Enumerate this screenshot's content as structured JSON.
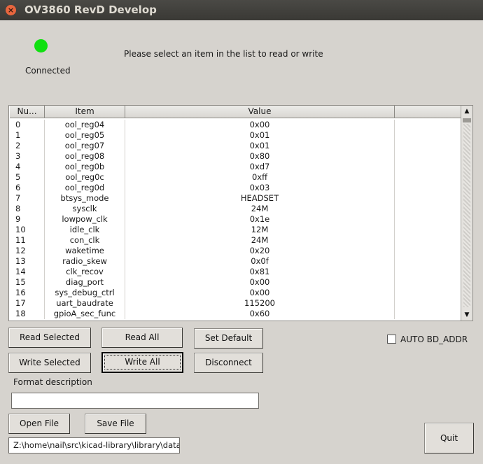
{
  "window": {
    "title": "OV3860 RevD Develop",
    "close_glyph": "×"
  },
  "status": {
    "label": "Connected",
    "color": "#10e010"
  },
  "hint": "Please select an item in the list to read or write",
  "table": {
    "headers": [
      "Nu...",
      "Item",
      "Value",
      ""
    ],
    "rows": [
      [
        "0",
        "ool_reg04",
        "0x00"
      ],
      [
        "1",
        "ool_reg05",
        "0x01"
      ],
      [
        "2",
        "ool_reg07",
        "0x01"
      ],
      [
        "3",
        "ool_reg08",
        "0x80"
      ],
      [
        "4",
        "ool_reg0b",
        "0xd7"
      ],
      [
        "5",
        "ool_reg0c",
        "0xff"
      ],
      [
        "6",
        "ool_reg0d",
        "0x03"
      ],
      [
        "7",
        "btsys_mode",
        "HEADSET"
      ],
      [
        "8",
        "sysclk",
        "24M"
      ],
      [
        "9",
        "lowpow_clk",
        "0x1e"
      ],
      [
        "10",
        "idle_clk",
        "12M"
      ],
      [
        "11",
        "con_clk",
        "24M"
      ],
      [
        "12",
        "waketime",
        "0x20"
      ],
      [
        "13",
        "radio_skew",
        "0x0f"
      ],
      [
        "14",
        "clk_recov",
        "0x81"
      ],
      [
        "15",
        "diag_port",
        "0x00"
      ],
      [
        "16",
        "sys_debug_ctrl",
        "0x00"
      ],
      [
        "17",
        "uart_baudrate",
        "115200"
      ],
      [
        "18",
        "gpioA_sec_func",
        "0x60"
      ]
    ],
    "scroll_up_icon": "▲",
    "scroll_down_icon": "▼"
  },
  "buttons": {
    "read_selected": "Read Selected",
    "read_all": "Read All",
    "set_default": "Set Default",
    "write_selected": "Write Selected",
    "write_all": "Write All",
    "disconnect": "Disconnect",
    "open_file": "Open File",
    "save_file": "Save File",
    "quit": "Quit"
  },
  "auto_bd_addr": {
    "label": "AUTO BD_ADDR",
    "checked": false
  },
  "format_description": {
    "label": "Format description",
    "value": ""
  },
  "path_field": {
    "value": "Z:\\home\\nail\\src\\kicad-library\\library\\datas"
  }
}
